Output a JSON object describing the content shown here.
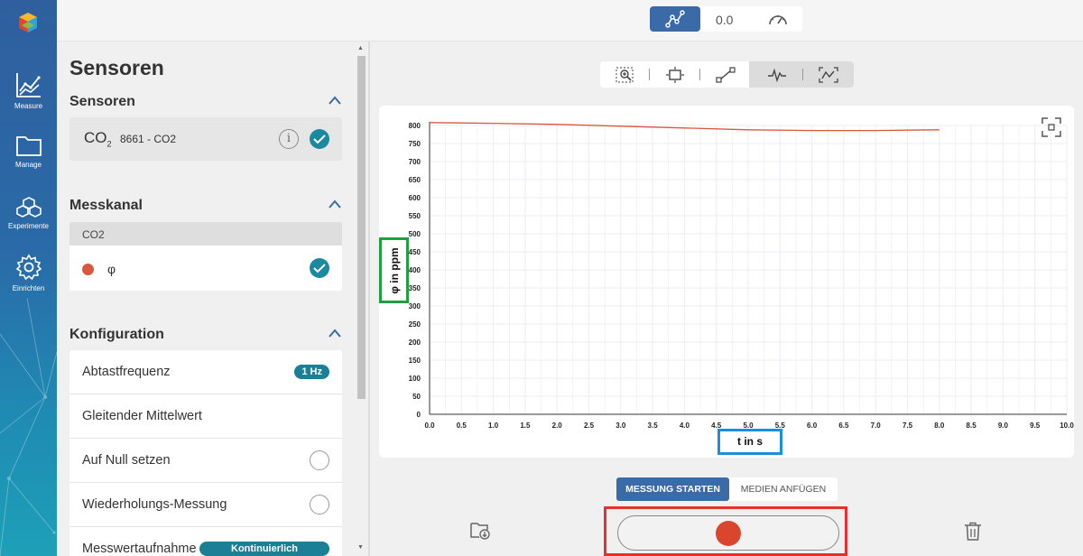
{
  "rail": {
    "items": [
      {
        "label": "Measure",
        "icon": "chart-line-icon"
      },
      {
        "label": "Manage",
        "icon": "folder-icon"
      },
      {
        "label": "Experimente",
        "icon": "cubes-icon"
      },
      {
        "label": "Einrichten",
        "icon": "gear-icon"
      }
    ]
  },
  "topbar": {
    "value": "0.0"
  },
  "sidebar": {
    "title": "Sensoren",
    "sensors": {
      "heading": "Sensoren",
      "icon_text": "CO",
      "icon_sub": "2",
      "sensor_name": "8661 - CO2",
      "info": "i"
    },
    "channel": {
      "heading": "Messkanal",
      "group": "CO2",
      "symbol": "φ",
      "color": "#d9573e"
    },
    "config": {
      "heading": "Konfiguration",
      "rows": [
        {
          "label": "Abtastfrequenz",
          "badge": "1 Hz"
        },
        {
          "label": "Gleitender Mittelwert"
        },
        {
          "label": "Auf Null setzen"
        },
        {
          "label": "Wiederholungs-Messung"
        },
        {
          "label": "Messwertaufnahme",
          "badge": "Kontinuierlich"
        }
      ]
    }
  },
  "controls": {
    "start_label": "MESSUNG STARTEN",
    "append_label": "MEDIEN ANFÜGEN"
  },
  "chart_data": {
    "type": "line",
    "xlabel": "t in s",
    "ylabel": "φ in ppm",
    "xlim": [
      0,
      10
    ],
    "ylim": [
      0,
      800
    ],
    "xticks": [
      0,
      0.5,
      1,
      1.5,
      2,
      2.5,
      3,
      3.5,
      4,
      4.5,
      5,
      5.5,
      6,
      6.5,
      7,
      7.5,
      8,
      8.5,
      9,
      9.5,
      10
    ],
    "yticks": [
      0,
      50,
      100,
      150,
      200,
      250,
      300,
      350,
      400,
      450,
      500,
      550,
      600,
      650,
      700,
      750,
      800
    ],
    "tick_labels_y": [
      "0",
      "50",
      "100",
      "150",
      "200",
      "250",
      "300",
      "350",
      "400",
      "450",
      "500",
      "550",
      "600",
      "650",
      "700",
      "750",
      "800"
    ],
    "grid": true,
    "series": [
      {
        "color": "#d9573e",
        "x": [
          0,
          1,
          2,
          3,
          4,
          5,
          6,
          7,
          8
        ],
        "y": [
          808,
          806,
          803,
          798,
          793,
          788,
          786,
          786,
          788
        ]
      }
    ]
  }
}
